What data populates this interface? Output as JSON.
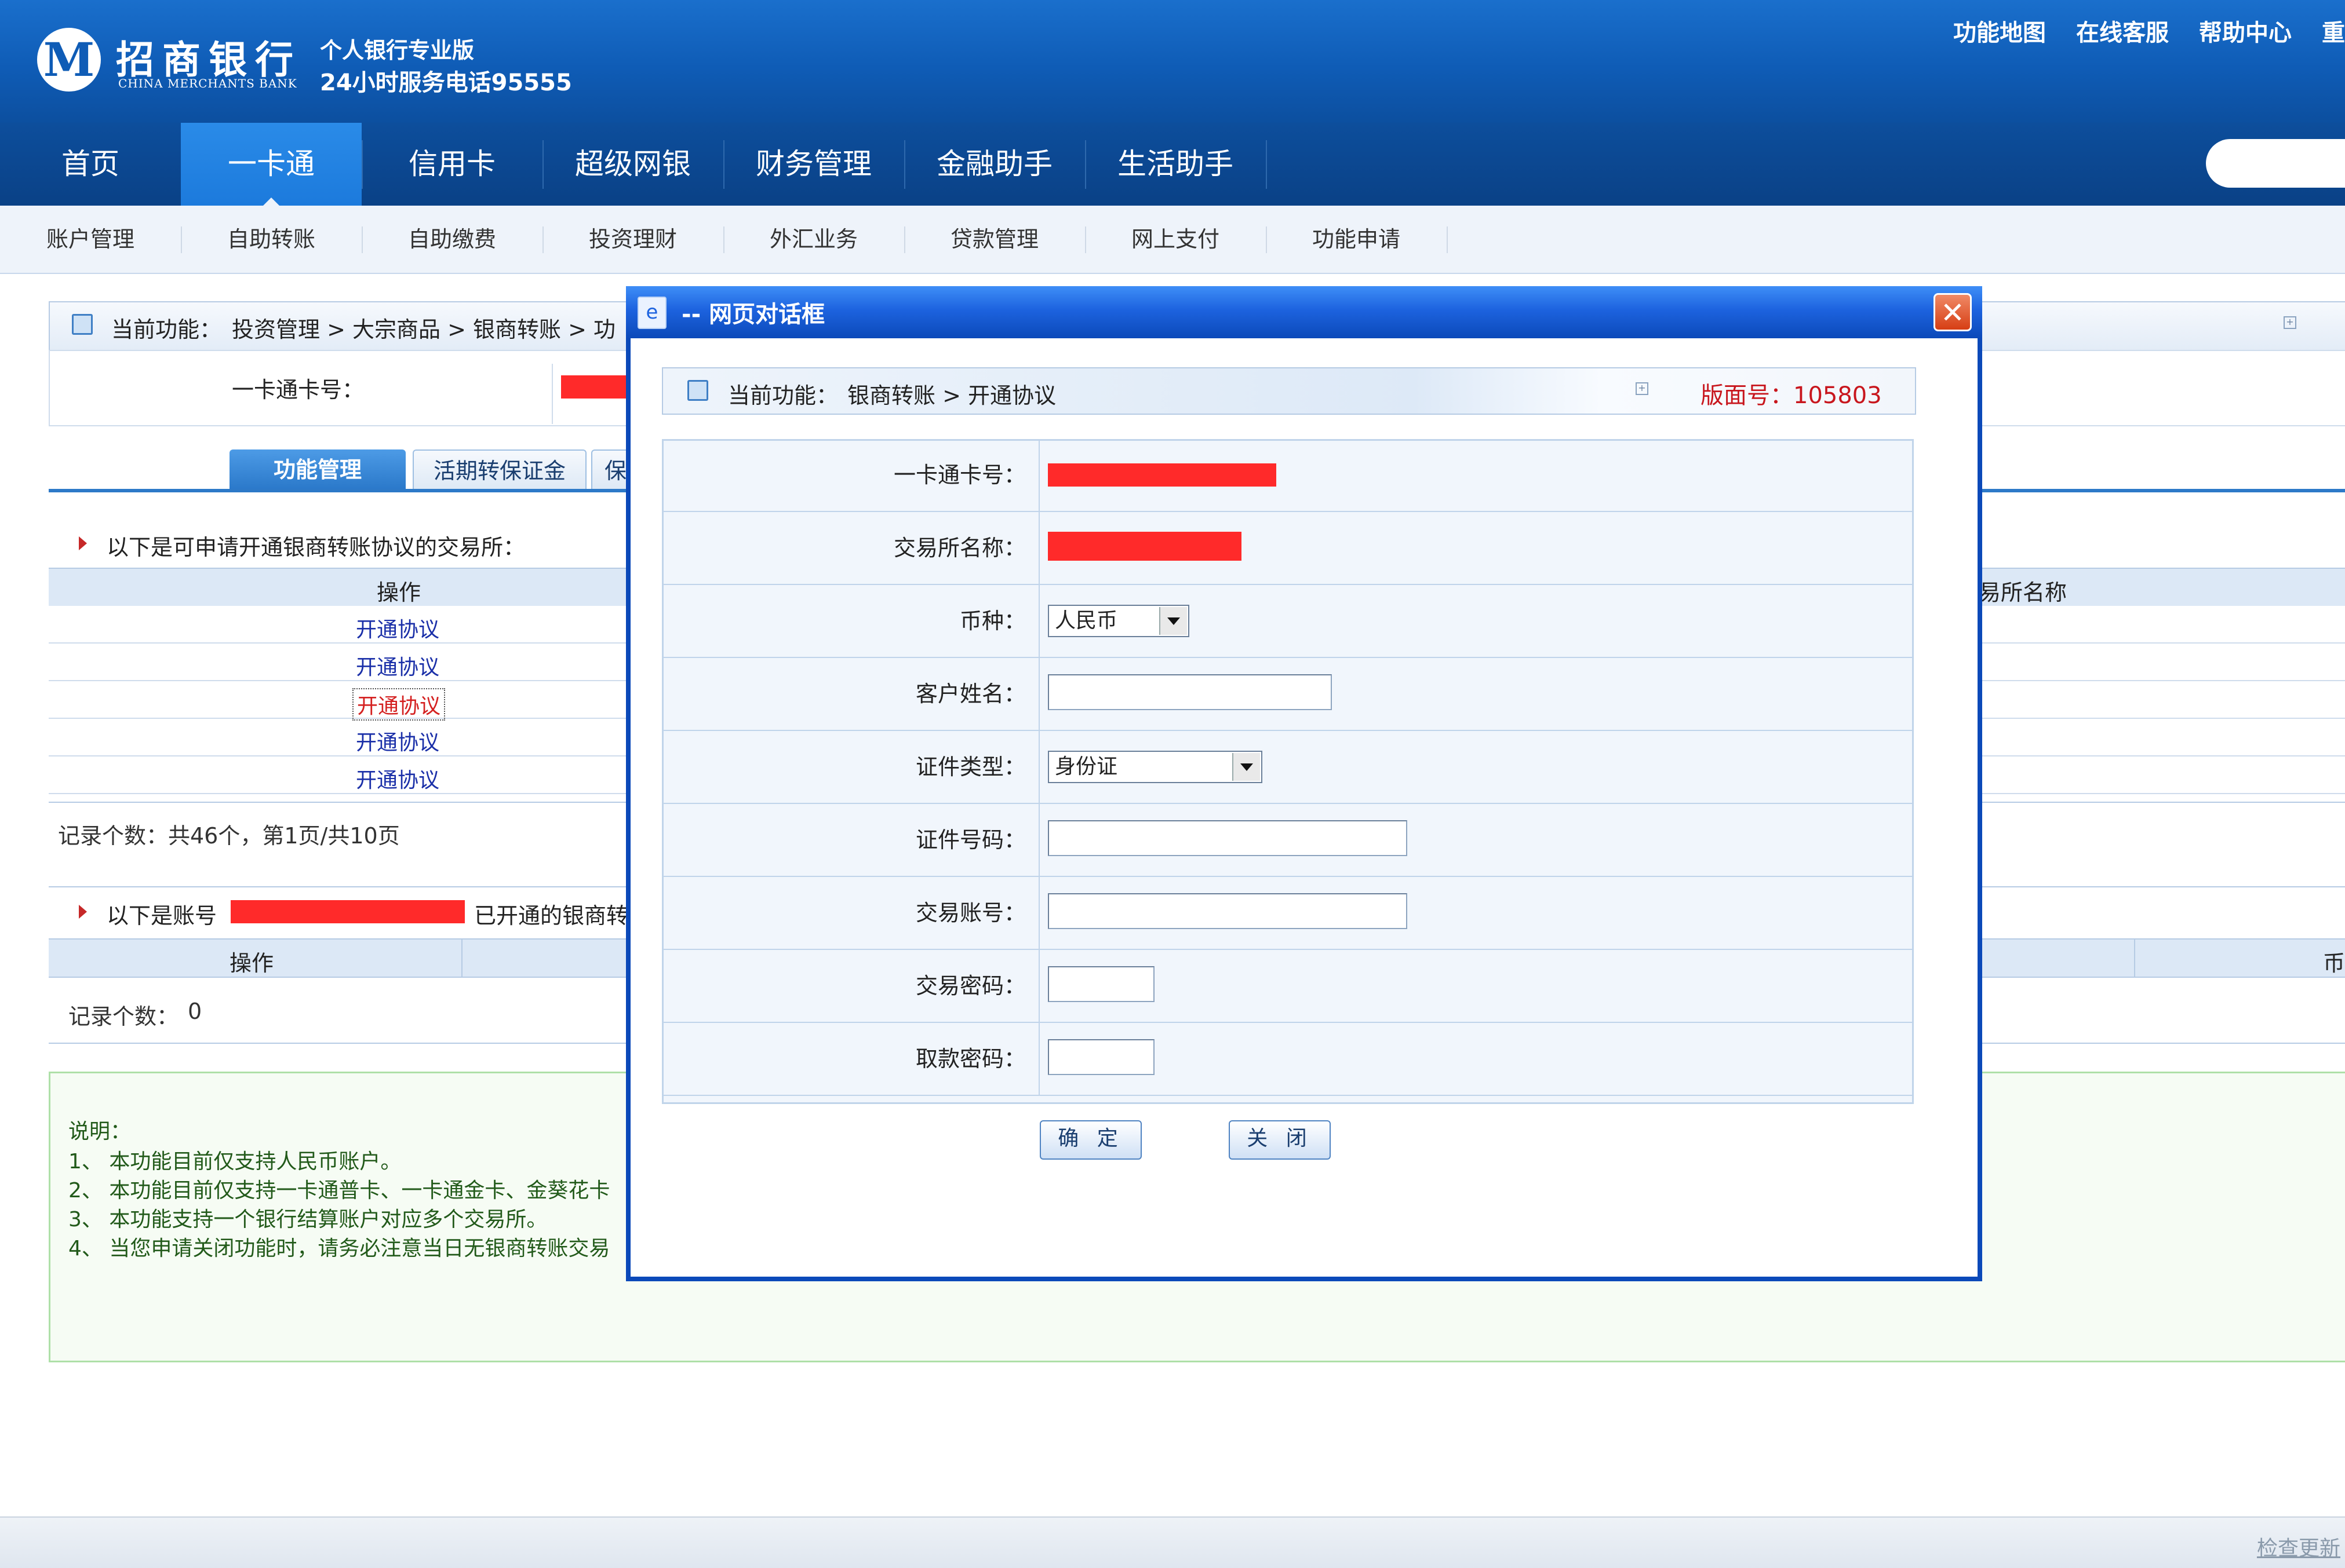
{
  "header": {
    "logo_glyph": "M",
    "bank_name_cn": "招商银行",
    "bank_name_en": "CHINA MERCHANTS BANK",
    "edition": "个人银行专业版",
    "hotline": "24小时服务电话95555",
    "top_links": [
      "功能地图",
      "在线客服",
      "帮助中心",
      "重"
    ]
  },
  "main_nav": {
    "tabs": [
      "首页",
      "一卡通",
      "信用卡",
      "超级网银",
      "财务管理",
      "金融助手",
      "生活助手"
    ],
    "active": "一卡通"
  },
  "sub_nav": [
    "账户管理",
    "自助转账",
    "自助缴费",
    "投资理财",
    "外汇业务",
    "贷款管理",
    "网上支付",
    "功能申请"
  ],
  "background": {
    "breadcrumb_label": "当前功能：",
    "breadcrumb": "投资管理 > 大宗商品 > 银商转账 > 功",
    "card_label": "一卡通卡号：",
    "func_tabs": [
      "功能管理",
      "活期转保证金",
      "保"
    ],
    "section1_title": "以下是可申请开通银商转账协议的交易所：",
    "col_operation": "操作",
    "col_exchange_partial": "易所名称",
    "rows": [
      "开通协议",
      "开通协议",
      "开通协议",
      "开通协议",
      "开通协议"
    ],
    "focused_row": 2,
    "records1": "记录个数：共46个，第1页/共10页",
    "section2_prefix": "以下是账号",
    "section2_suffix": "已开通的银商转",
    "col2_operation": "操作",
    "col2_currency_partial": "币",
    "records2_label": "记录个数：",
    "records2_value": "0",
    "notes_title": "说明：",
    "notes": [
      "1、  本功能目前仅支持人民币账户。",
      "2、  本功能目前仅支持一卡通普卡、一卡通金卡、金葵花卡",
      "3、  本功能支持一个银行结算账户对应多个交易所。",
      "4、  当您申请关闭功能时，请务必注意当日无银商转账交易"
    ],
    "footer_link": "检查更新"
  },
  "dialog": {
    "title": "-- 网页对话框",
    "close_glyph": "✕",
    "breadcrumb_label": "当前功能：",
    "breadcrumb": "银商转账 > 开通协议",
    "version_label": "版面号：",
    "version": "105803",
    "fields": {
      "card_no": "一卡通卡号：",
      "exchange": "交易所名称：",
      "currency": "币种：",
      "customer_name": "客户姓名：",
      "id_type": "证件类型：",
      "id_no": "证件号码：",
      "trade_account": "交易账号：",
      "trade_password": "交易密码：",
      "withdraw_password": "取款密码："
    },
    "currency_value": "人民币",
    "id_type_value": "身份证",
    "confirm": "确 定",
    "close": "关 闭"
  },
  "colors": {
    "brand_blue": "#0f5cb6",
    "dialog_border": "#0b49b9",
    "redaction": "#ff2a2a",
    "version_red": "#c8161d"
  },
  "icons": [
    "bank-logo-icon",
    "breadcrumb-icon",
    "dialog-app-icon",
    "close-icon",
    "dropdown-arrow-icon",
    "expand-icon"
  ]
}
